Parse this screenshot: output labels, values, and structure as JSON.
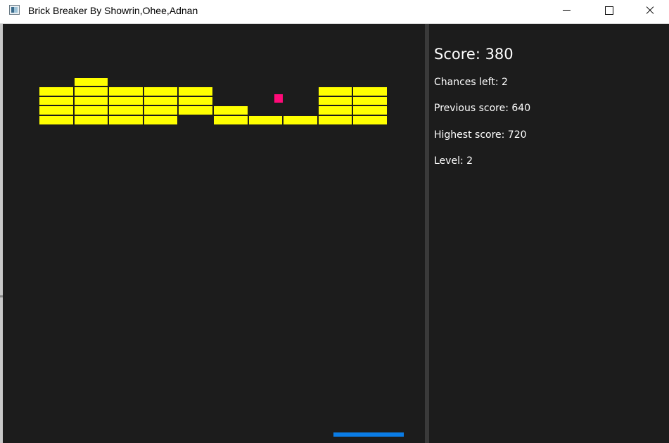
{
  "window": {
    "title": "Brick Breaker By Showrin,Ohee,Adnan",
    "icon": "app-window-icon",
    "controls": [
      "minimize-icon",
      "maximize-icon",
      "close-icon"
    ]
  },
  "game": {
    "background": "#1c1c1c",
    "brick_color": "#ffff00",
    "ball_color": "#ff0a78",
    "paddle_color": "#0a7ce6",
    "bricks": {
      "columns": 10,
      "rows": 6,
      "grid_cells": [
        "..........",
        ".X........",
        "XXXXX...XX",
        "XXXXX...XX",
        "XXXXXX..XX",
        "XXXX.XXXXX"
      ]
    }
  },
  "panel": {
    "score": "Score: 380",
    "chances": "Chances left: 2",
    "previous": "Previous score: 640",
    "highest": "Highest score: 720",
    "level": "Level: 2"
  }
}
